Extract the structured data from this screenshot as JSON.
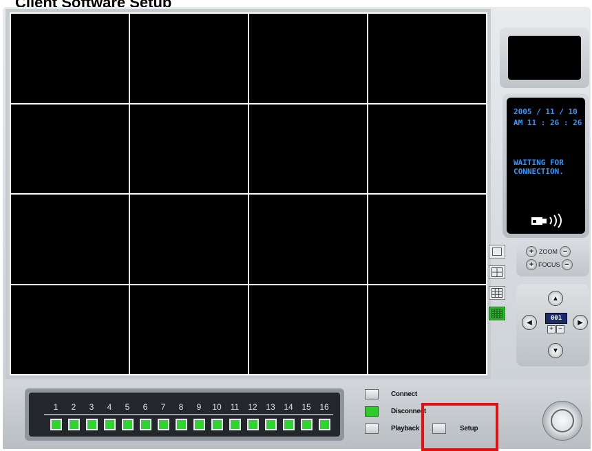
{
  "window": {
    "title": "Client Software Setup"
  },
  "status": {
    "date": "2005 / 11 / 10",
    "time": "AM 11 : 26 : 26",
    "message_line1": "WAITING FOR",
    "message_line2": "CONNECTION.",
    "camera_icon": "camera-sound-icon"
  },
  "zoom_focus": {
    "zoom_label": "ZOOM",
    "focus_label": "FOCUS",
    "plus": "+",
    "minus": "−"
  },
  "ptz": {
    "preset_value": "001",
    "plus": "+",
    "minus": "−"
  },
  "channels": {
    "numbers": [
      "1",
      "2",
      "3",
      "4",
      "5",
      "6",
      "7",
      "8",
      "9",
      "10",
      "11",
      "12",
      "13",
      "14",
      "15",
      "16"
    ]
  },
  "controls": {
    "connect_label": "Connect",
    "disconnect_label": "Disconnect",
    "playback_label": "Playback",
    "setup_label": "Setup"
  },
  "colors": {
    "active_green": "#2dd62d",
    "lcd_blue": "#3399ff",
    "highlight_red": "#e31010"
  }
}
